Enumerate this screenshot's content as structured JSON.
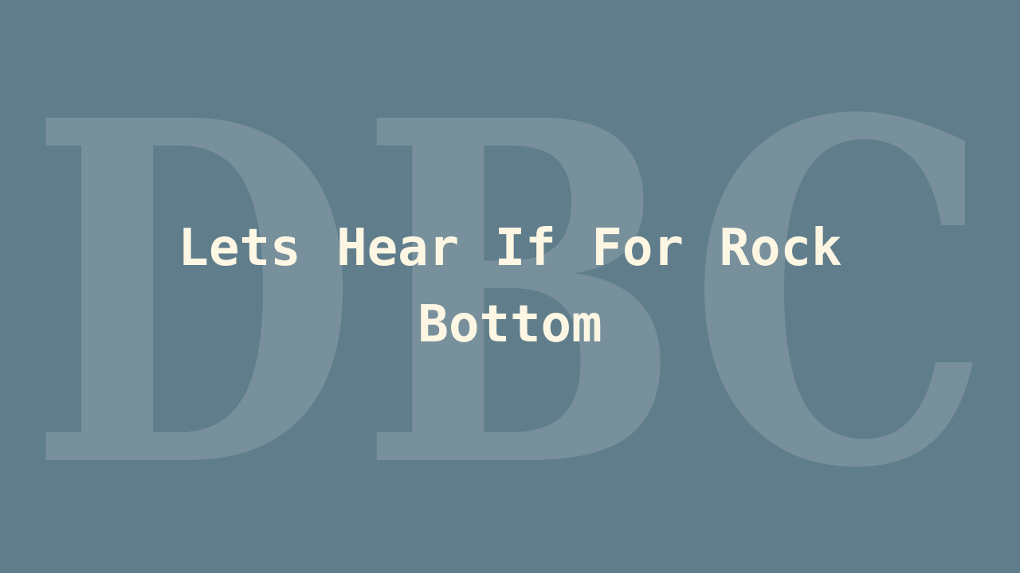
{
  "watermark": {
    "text": "DBC"
  },
  "title": {
    "line1": "Lets Hear If For Rock",
    "line2": "Bottom"
  },
  "colors": {
    "background": "#607d8b",
    "title_text": "#fdf6e3",
    "watermark_fill": "#ffffff"
  }
}
